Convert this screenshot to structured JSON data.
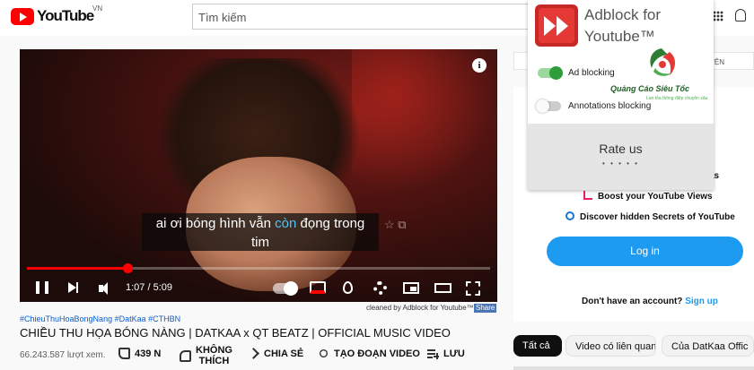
{
  "header": {
    "logo_text": "YouTube",
    "logo_region": "VN",
    "search_placeholder": "Tìm kiếm"
  },
  "player": {
    "caption_line1_before": "ai ơi bóng hình vẫn ",
    "caption_highlight": "còn",
    "caption_line1_after": " đọng trong",
    "caption_line2": "tim",
    "time_display": "1:07 / 5:09",
    "progress_fraction": 0.217,
    "cleaned_note": "cleaned by Adblock for Youtube™",
    "share_badge": "Share"
  },
  "video": {
    "hashtags": "#ChieuThuHoaBongNang #DatKaa #CTHBN",
    "title": "CHIỀU THU HỌA BÓNG NÀNG | DATKAA x QT BEATZ | OFFICIAL MUSIC VIDEO",
    "views": "66.243.587 lượt xem.",
    "like_count": "439 N",
    "dislike_line1": "KHÔNG",
    "dislike_line2": "THÍCH",
    "share_label": "CHIA SẺ",
    "clip_label": "TẠO ĐOẠN VIDEO",
    "save_label": "LƯU"
  },
  "sidebar": {
    "tab_partial": "YỆN",
    "promo_partial": "as",
    "promo_boost": "Boost your YouTube Views",
    "promo_discover": "Discover hidden Secrets of YouTube",
    "login_label": "Log in",
    "no_account": "Don't have an account?",
    "signup_label": "Sign up",
    "chips": [
      "Tất cả",
      "Video có liên quan",
      "Của DatKaa Offic"
    ]
  },
  "popup": {
    "title": "Adblock for Youtube™",
    "ad_blocking_label": "Ad blocking",
    "ad_blocking_on": true,
    "annotations_label": "Annotations blocking",
    "annotations_on": false,
    "rate_label": "Rate us",
    "rate_stars": "• • • • •"
  },
  "watermark": {
    "brand_name": "Quảng Cáo Siêu Tốc",
    "brand_sub": "Lan tỏa thông điệp chuyên sâu"
  },
  "colors": {
    "youtube_red": "#ff0000",
    "link_blue": "#065fd4",
    "login_blue": "#1d9bf0",
    "toggle_green": "#2e9d3a"
  }
}
